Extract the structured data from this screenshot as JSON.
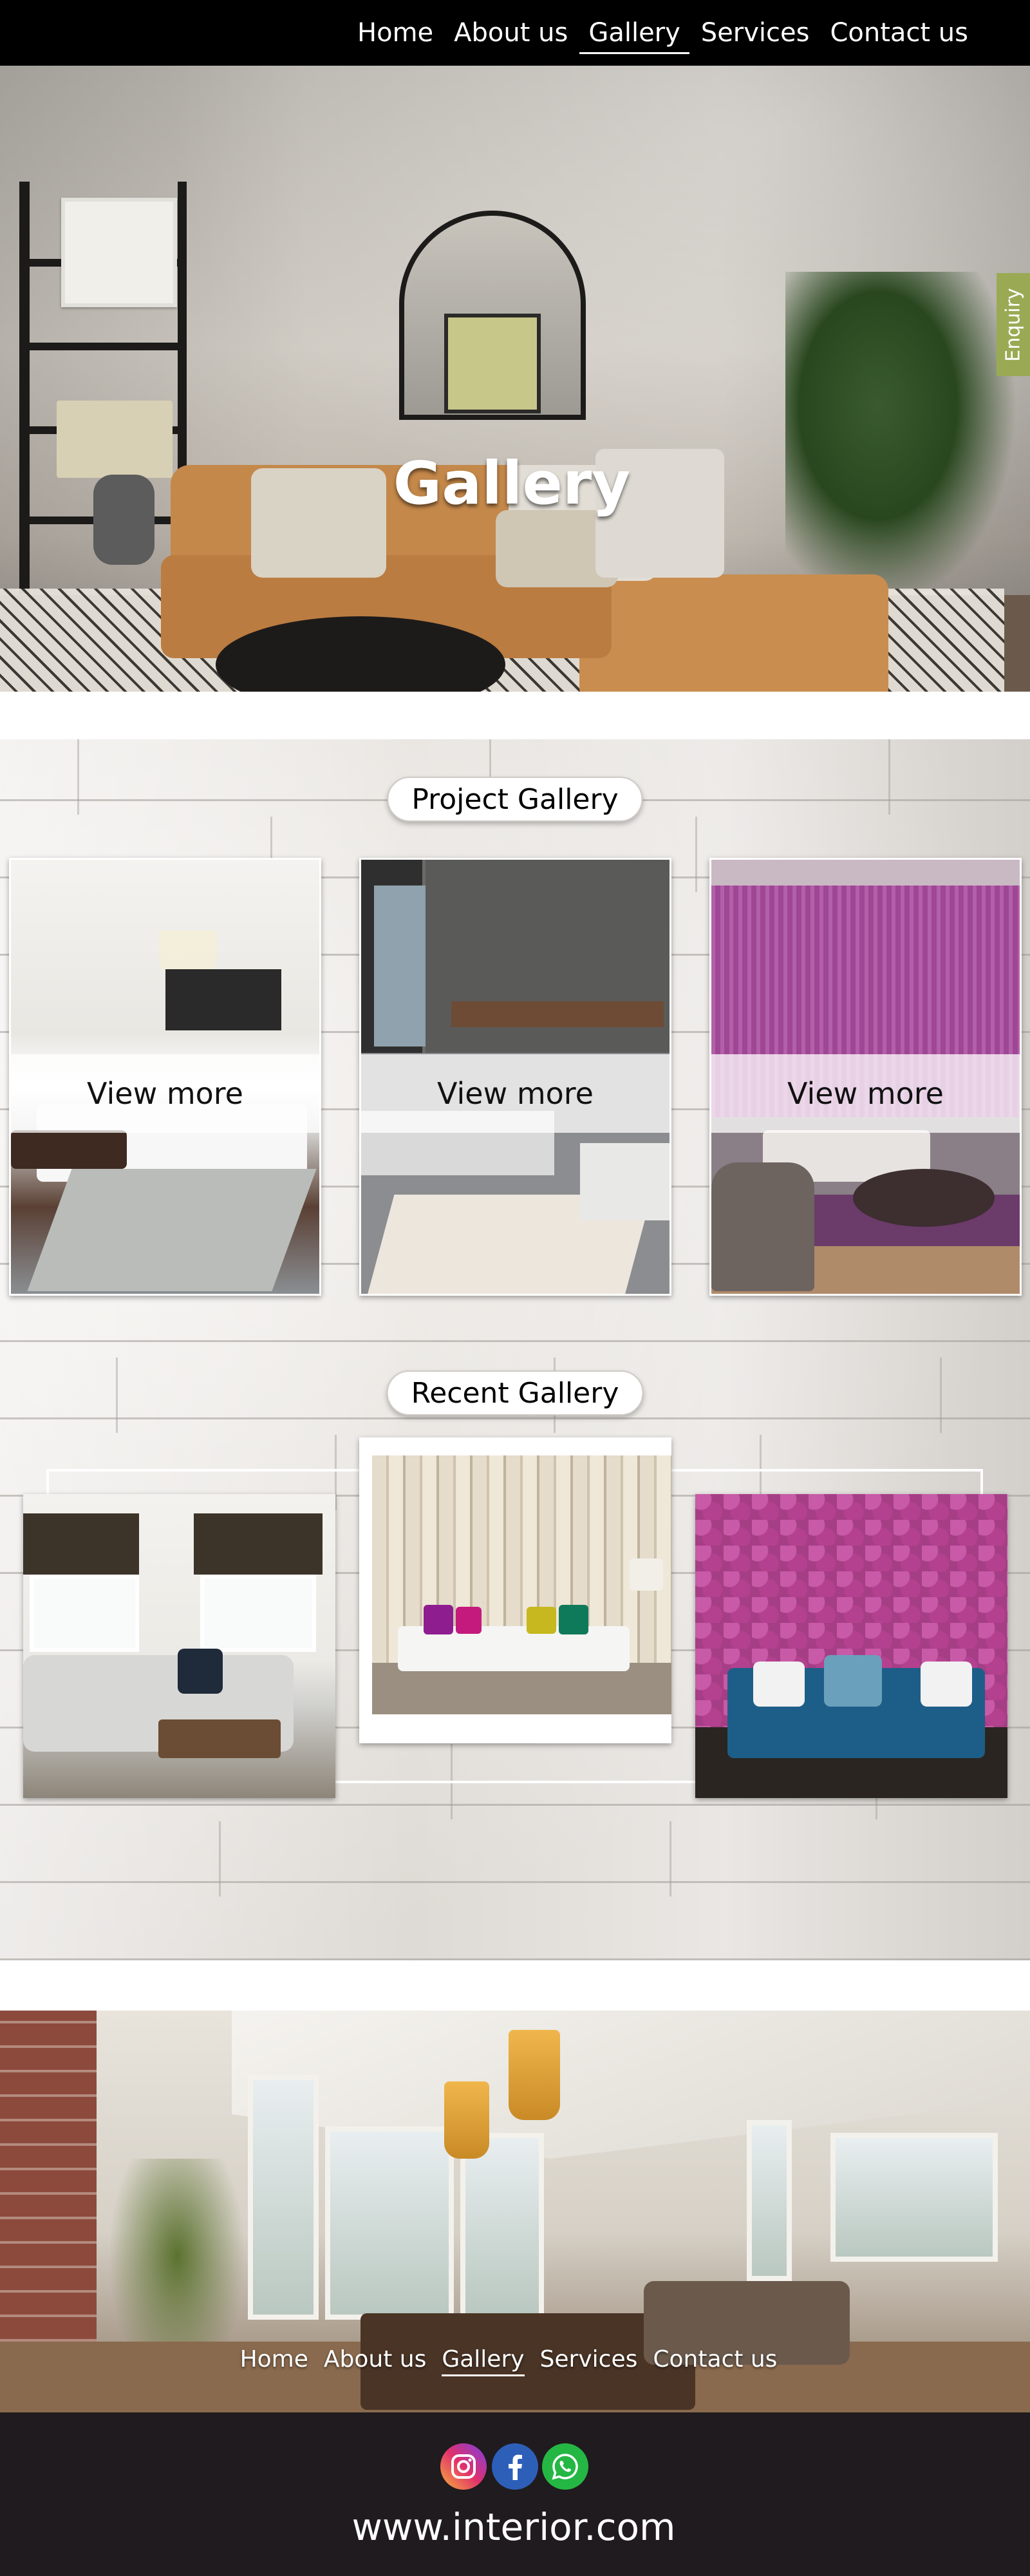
{
  "nav": {
    "items": [
      {
        "label": "Home"
      },
      {
        "label": "About us"
      },
      {
        "label": "Gallery",
        "active": true
      },
      {
        "label": "Services"
      },
      {
        "label": "Contact us"
      }
    ]
  },
  "hero": {
    "title": "Gallery"
  },
  "enquiry": {
    "label": "Enquiry"
  },
  "project_gallery": {
    "heading": "Project Gallery",
    "cards": [
      {
        "button": "View more"
      },
      {
        "button": "View more"
      },
      {
        "button": "View more"
      }
    ]
  },
  "recent_gallery": {
    "heading": "Recent Gallery"
  },
  "footer": {
    "nav": [
      {
        "label": "Home"
      },
      {
        "label": "About us"
      },
      {
        "label": "Gallery",
        "active": true
      },
      {
        "label": "Services"
      },
      {
        "label": "Contact us"
      }
    ],
    "social_icons": [
      "instagram-icon",
      "facebook-icon",
      "whatsapp-icon"
    ],
    "website": "www.interior.com"
  },
  "colors": {
    "nav_bg": "#000000",
    "enquiry_tab": "#9aaa54",
    "footer_bar": "#1f1b1e"
  }
}
